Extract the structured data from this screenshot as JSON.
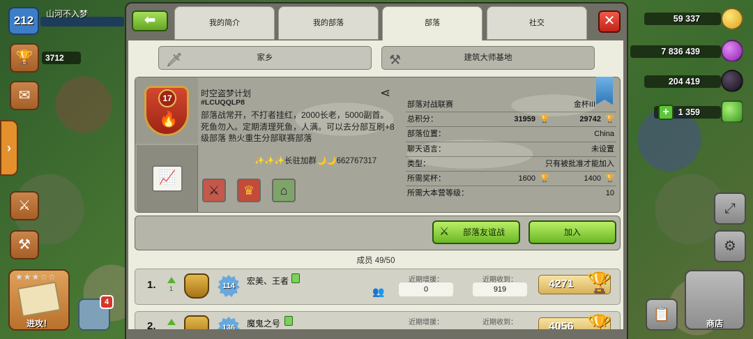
{
  "hud": {
    "player_level": "212",
    "player_name": "山河不入梦",
    "trophies": "3712",
    "attack_label": "进攻！",
    "notifications": "4",
    "gold": "59 337",
    "elixir": "7 836 439",
    "dark_elixir": "204 419",
    "gems": "1 359",
    "shop_label": "商店",
    "colors": {
      "gold": "#f2c431",
      "elixir": "#b43fd6",
      "dark_elixir": "#2b2234",
      "gems": "#5cc63b"
    }
  },
  "tabs": [
    {
      "label": "我的简介"
    },
    {
      "label": "我的部落"
    },
    {
      "label": "部落",
      "active": true
    },
    {
      "label": "社交"
    }
  ],
  "subtabs": [
    {
      "label": "家乡",
      "icon": "sword-icon"
    },
    {
      "label": "建筑大师基地",
      "icon": "crossed-hammers-icon"
    }
  ],
  "clan": {
    "level": "17",
    "name": "时空盗梦计划",
    "tag": "#LCUQQLP8",
    "description": "部落战常开，不打者挂红，2000长老，5000副首。死鱼勿入。定期清理死鱼，人满。可以去分部互刷+8级部落 熟火重生分部联赛部落",
    "contact": "✨✨✨长驻加群🌙🌙662767317",
    "stats": [
      {
        "key": "部落对战联赛",
        "value": "金杯III"
      },
      {
        "key": "总积分：",
        "value": "29742",
        "value2": "31959"
      },
      {
        "key": "部落位置：",
        "value": "China"
      },
      {
        "key": "聊天语言：",
        "value": "未设置"
      },
      {
        "key": "类型：",
        "value": "只有被批准才能加入"
      },
      {
        "key": "所需奖杯：",
        "value": "1400",
        "value2": "1600"
      },
      {
        "key": "所需大本营等级：",
        "value": "10"
      }
    ]
  },
  "actions": {
    "war_label": "部落友谊战",
    "join_label": "加入"
  },
  "members_title": "成员 49/50",
  "members": [
    {
      "rank": "1.",
      "rank_change": "1",
      "xp": "114",
      "name": "宏美、王者",
      "donated_label": "近期增援：",
      "donated": "0",
      "received_label": "近期收到：",
      "received": "919",
      "trophies": "4271"
    },
    {
      "rank": "2.",
      "rank_change": "",
      "xp": "136",
      "name": "魔鬼之号",
      "donated_label": "近期增援：",
      "donated": "",
      "received_label": "近期收到：",
      "received": "",
      "trophies": "4056"
    }
  ]
}
